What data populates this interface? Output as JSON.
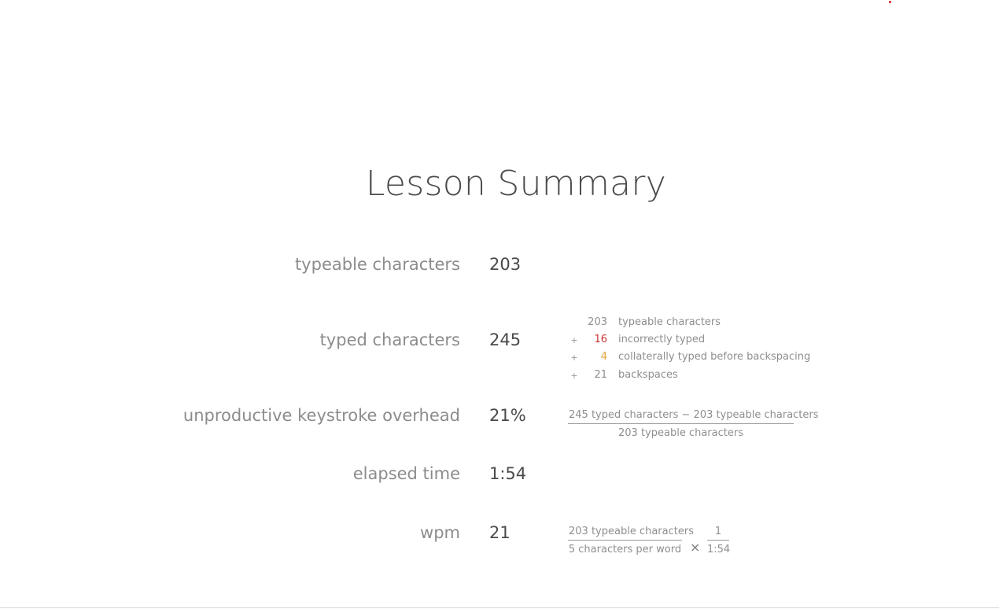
{
  "title": "Lesson Summary",
  "stats": [
    {
      "label": "typeable characters",
      "value": "203"
    },
    {
      "label": "typed characters",
      "value": "245"
    },
    {
      "label": "unproductive keystroke overhead",
      "value": "21%"
    },
    {
      "label": "elapsed time",
      "value": "1:54"
    },
    {
      "label": "wpm",
      "value": "21"
    }
  ],
  "breakdown": [
    {
      "op": "",
      "num": "203",
      "desc": "typeable characters"
    },
    {
      "op": "+",
      "num": "16",
      "desc": "incorrectly typed",
      "color": "#cc3333"
    },
    {
      "op": "+",
      "num": "4",
      "desc": "collaterally typed before backspacing",
      "color": "#e3a33c"
    },
    {
      "op": "+",
      "num": "21",
      "desc": "backspaces"
    }
  ],
  "overhead_formula": {
    "numerator": "245 typed characters − 203 typeable characters",
    "denominator": "203 typeable characters"
  },
  "wpm_formula": {
    "left_numerator": "203 typeable characters",
    "left_denominator": "5 characters per word",
    "operator": "×",
    "right_numerator": "1",
    "right_denominator": "1:54"
  },
  "colors": {
    "accent_red": "#cc3333",
    "accent_orange": "#e3a33c",
    "cursor_dot": "#cc1a1a"
  }
}
